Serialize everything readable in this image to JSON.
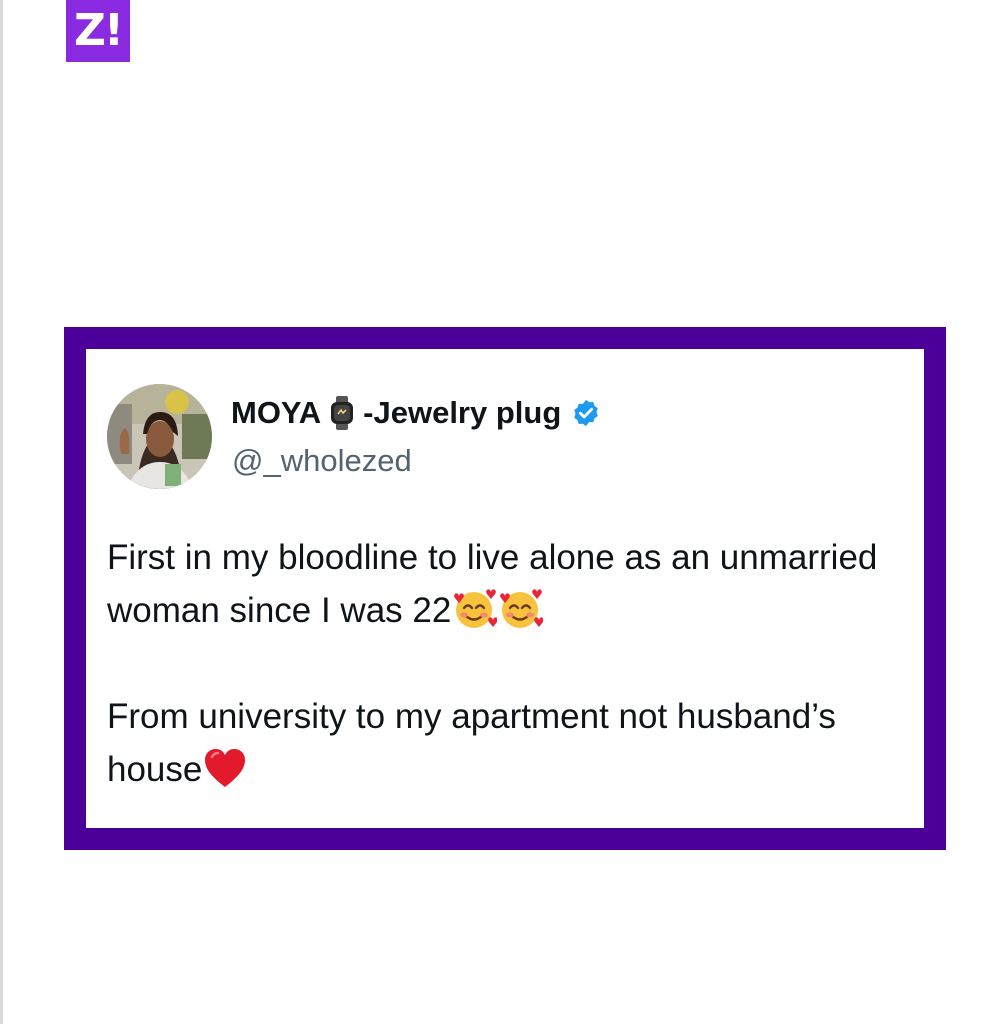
{
  "logo": {
    "text": "Z!"
  },
  "tweet": {
    "display_name": "MOYA",
    "name_suffix": "-Jewelry plug",
    "handle": "@_wholezed",
    "paragraph_1": "First in my bloodline to live alone as an unmarried woman since  I was 22",
    "paragraph_2": "From university to my apartment not husband’s house",
    "icons": [
      "watch-icon",
      "verified-badge-icon",
      "smiling-face-with-hearts-icon",
      "smiling-face-with-hearts-icon",
      "red-heart-icon"
    ]
  },
  "colors": {
    "frame": "#4c0099",
    "logo": "#8a2be2",
    "verified": "#1d9bf0",
    "text": "#0f1419",
    "handle": "#536471"
  }
}
